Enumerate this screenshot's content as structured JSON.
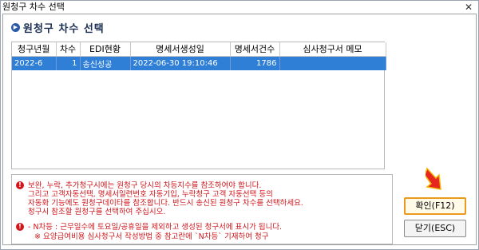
{
  "window": {
    "title": "원청구 차수 선택",
    "close_label": "✕"
  },
  "header": {
    "title": "원청구 차수 선택"
  },
  "table": {
    "columns": [
      "청구년월",
      "차수",
      "EDI현황",
      "명세서생성일",
      "명세서건수",
      "심사청구서 메모"
    ],
    "rows": [
      [
        "2022-6",
        "1",
        "송신성공",
        "2022-06-30 19:10:46",
        "1786",
        ""
      ]
    ]
  },
  "notes": {
    "line1": "보완, 누락, 추가청구시에는 원청구 당시의 차등지수를 참조하여야 합니다.",
    "line2": "그리고 고객자동선택, 명세서일련번호 자동기입, 누락청구 고객 자동선택 등의",
    "line3": "자동화 기능에도 원청구데이타를 참조합니다. 반드시 송신된 원청구 차수를 선택하세요.",
    "line4": "청구시 참조할 원청구를 선택하여 주십시오.",
    "line5": "- N차등 : 근무일수에 토요일/공휴일을 제외하고 생성된 청구서에 표시가 됩니다.",
    "line6": "※ 요양급여비용 심사청구서 작성방법 중 참고란에 `N차등` 기재하여 청구"
  },
  "buttons": {
    "confirm": "확인(F12)",
    "close": "닫기(ESC)"
  },
  "colors": {
    "selection": "#2f7fd7",
    "warning": "#d0161b",
    "highlight": "#e99a1f",
    "header": "#1b2f55"
  }
}
